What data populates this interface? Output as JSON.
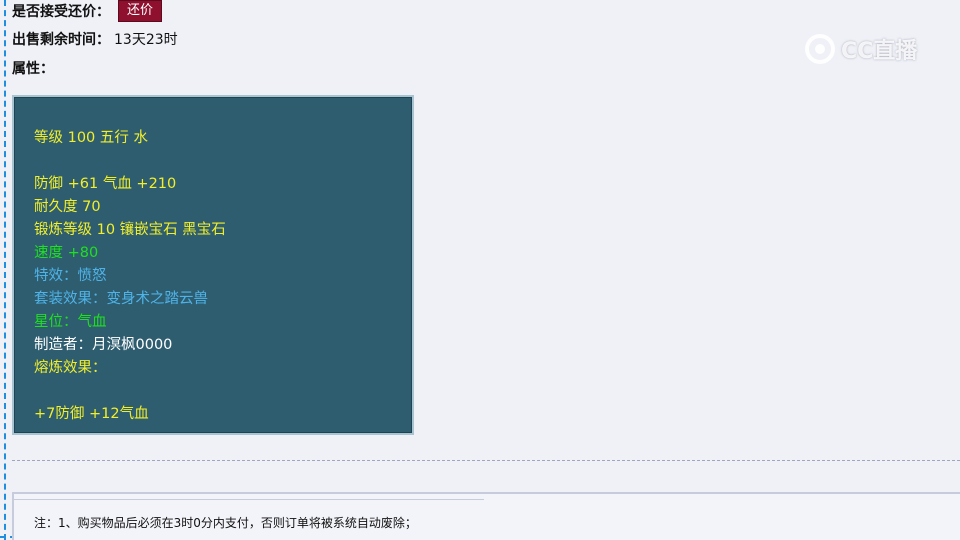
{
  "bargain": {
    "label": "是否接受还价：",
    "button": "还价"
  },
  "time_left": {
    "label": "出售剩余时间：",
    "value": "13天23时"
  },
  "attributes": {
    "label": "属性：",
    "lines": [
      "等级 100 五行 水",
      "防御 +61 气血 +210",
      "耐久度 70",
      "锻炼等级 10 镶嵌宝石 黑宝石",
      "速度 +80",
      "特效：愤怒",
      "套装效果：变身术之踏云兽",
      "星位：气血",
      "制造者：月溟枫0000",
      "熔炼效果：",
      "+7防御 +12气血"
    ]
  },
  "colors": {
    "yellow": "#f2ef2a",
    "green": "#1fe01f",
    "cyan": "#4fb3e8",
    "white": "#ffffff",
    "panel_bg": "#2e5d70",
    "button_bg": "#8e0f2e"
  },
  "watermark": {
    "text": "CC直播",
    "icon": "cc-logo-icon"
  },
  "notice": {
    "text": "注：1、购买物品后必须在3时0分内支付，否则订单将被系统自动废除；"
  }
}
